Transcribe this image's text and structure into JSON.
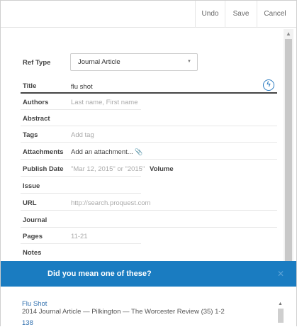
{
  "toolbar": {
    "undo": "Undo",
    "save": "Save",
    "cancel": "Cancel"
  },
  "form": {
    "ref_type": {
      "label": "Ref Type",
      "value": "Journal Article"
    },
    "title": {
      "label": "Title",
      "value": "flu shot"
    },
    "authors": {
      "label": "Authors",
      "placeholder": "Last name, First name"
    },
    "abstract": {
      "label": "Abstract"
    },
    "tags": {
      "label": "Tags",
      "placeholder": "Add tag"
    },
    "attachments": {
      "label": "Attachments",
      "placeholder": "Add an attachment..."
    },
    "publish_date": {
      "label": "Publish Date",
      "placeholder": "\"Mar 12, 2015\" or \"2015\""
    },
    "volume": {
      "label": "Volume"
    },
    "issue": {
      "label": "Issue"
    },
    "url": {
      "label": "URL",
      "placeholder": "http://search.proquest.com"
    },
    "journal": {
      "label": "Journal"
    },
    "pages": {
      "label": "Pages",
      "placeholder": "11-21"
    },
    "notes": {
      "label": "Notes"
    }
  },
  "suggestions": {
    "header": "Did you mean one of these?",
    "close": "✕",
    "items": [
      {
        "title": "Flu Shot",
        "detail": "2014 Journal Article — Pilkington — The Worcester Review (35) 1-2"
      },
      {
        "title": "138"
      }
    ]
  }
}
